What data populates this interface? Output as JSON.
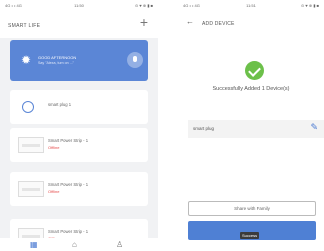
{
  "left": {
    "status": {
      "carrier": "4G •  • 4G",
      "time": "11:50",
      "right": "⊙ ♥ ⊕ ▮ ■"
    },
    "header": {
      "title": "SMART LIFE",
      "add": "+"
    },
    "weather": {
      "greeting": "GOOD AFTERNOON",
      "hint": "Say \"Alexa, turn on ...\"",
      "icon": "sun-icon"
    },
    "devices": [
      {
        "name": "smart plug 1",
        "icon": "ring-icon"
      },
      {
        "name": "Smart Power Strip - 1",
        "status": "Offline"
      },
      {
        "name": "Smart Power Strip - 1",
        "status": "Offline"
      },
      {
        "name": "Smart Power Strip - 1",
        "status": "Offline"
      }
    ],
    "nav": {
      "home": "▦",
      "scene": "⌂",
      "profile": "♙"
    },
    "accent": "#5b86d6"
  },
  "right": {
    "status": {
      "carrier": "4G •  • 4G",
      "time": "11:51",
      "right": "⊙ ♥ ⊕ ▮ ■"
    },
    "header": {
      "back": "←",
      "title": "ADD DEVICE"
    },
    "success_text": "Successfully Added 1 Device(s)",
    "device": {
      "name": "smart plug",
      "edit": "✎"
    },
    "buttons": {
      "share": "Share with Family",
      "done": "Success"
    },
    "success_color": "#6cc04a",
    "primary_color": "#4f80d4"
  }
}
